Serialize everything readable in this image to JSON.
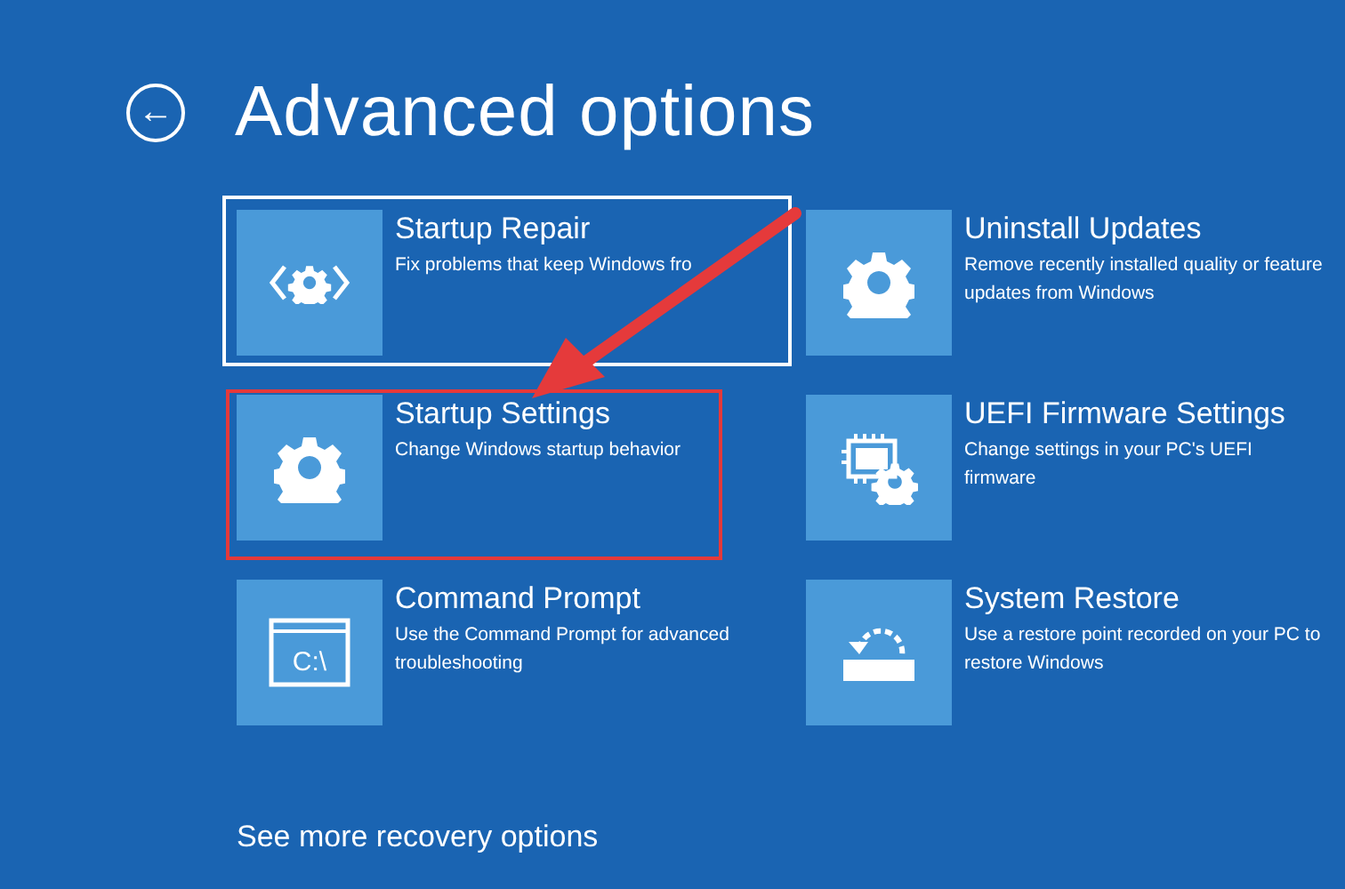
{
  "header": {
    "back_button": "←",
    "title": "Advanced options"
  },
  "options": [
    {
      "kind": "repair",
      "title": "Startup Repair",
      "description": "Fix problems that keep Windows fro",
      "focused": true,
      "highlighted": false
    },
    {
      "kind": "gear",
      "title": "Uninstall Updates",
      "description": "Remove recently installed quality or feature updates from Windows",
      "focused": false,
      "highlighted": false
    },
    {
      "kind": "gear",
      "title": "Startup Settings",
      "description": "Change Windows startup behavior",
      "focused": false,
      "highlighted": true
    },
    {
      "kind": "firmware",
      "title": "UEFI Firmware Settings",
      "description": "Change settings in your PC's UEFI firmware",
      "focused": false,
      "highlighted": false
    },
    {
      "kind": "terminal",
      "title": "Command Prompt",
      "description": "Use the Command Prompt for advanced troubleshooting",
      "focused": false,
      "highlighted": false,
      "icon_label": "C:\\"
    },
    {
      "kind": "restore",
      "title": "System Restore",
      "description": "Use a restore point recorded on your PC to restore Windows",
      "focused": false,
      "highlighted": false
    }
  ],
  "more_link": "See more recovery options",
  "arrow_annotation": true
}
